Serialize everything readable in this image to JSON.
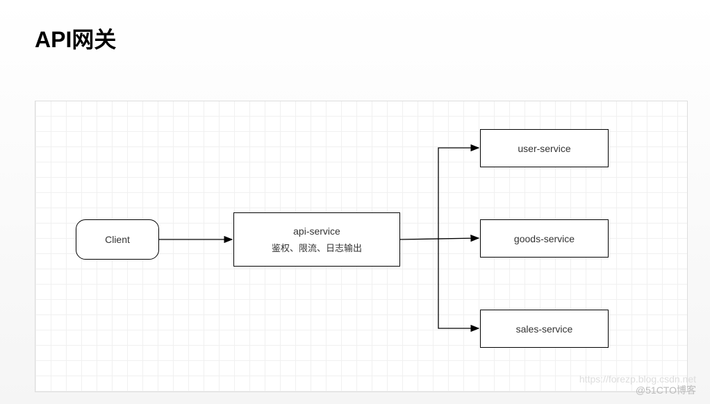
{
  "title": "API网关",
  "nodes": {
    "client": "Client",
    "api": {
      "name": "api-service",
      "desc": "鉴权、限流、日志输出"
    },
    "services": [
      "user-service",
      "goods-service",
      "sales-service"
    ]
  },
  "watermark_top": "https://forezp.blog.csdn.net",
  "watermark": "@51CTO博客"
}
